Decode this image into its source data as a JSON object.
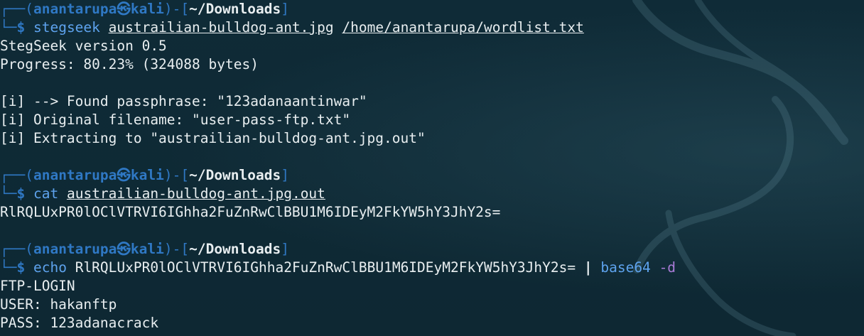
{
  "prompt": {
    "user": "anantarupa",
    "host": "kali",
    "path": "~/Downloads",
    "symbol": "$",
    "separator_icon": "kali-dragon-icon",
    "box_left": "┌──(",
    "box_mid": ")-[",
    "box_right": "]",
    "box_bottom": "└─"
  },
  "blocks": [
    {
      "command": "stegseek",
      "args": [
        "austrailian-bulldog-ant.jpg",
        "/home/anantarupa/wordlist.txt"
      ],
      "output": [
        "StegSeek version 0.5",
        "Progress: 80.23% (324088 bytes)",
        "",
        "[i] --> Found passphrase: \"123adanaantinwar\"",
        "[i] Original filename: \"user-pass-ftp.txt\"",
        "[i] Extracting to \"austrailian-bulldog-ant.jpg.out\""
      ]
    },
    {
      "command": "cat",
      "args": [
        "austrailian-bulldog-ant.jpg.out"
      ],
      "output": [
        "RlRQLUxPR0lOClVTRVI6IGhha2FuZnRwClBBU1M6IDEyM2FkYW5hY3JhY2s="
      ]
    },
    {
      "command": "echo",
      "args": [
        "RlRQLUxPR0lOClVTRVI6IGhha2FuZnRwClBBU1M6IDEyM2FkYW5hY3JhY2s="
      ],
      "pipe": "|",
      "pipe_command": "base64",
      "pipe_flag": "-d",
      "output": [
        "FTP-LOGIN",
        "USER: hakanftp",
        "PASS: 123adanacrack"
      ]
    }
  ],
  "colors": {
    "background": "#0f2a36",
    "prompt_blue": "#2f78c4",
    "command_blue": "#5ea3ee",
    "flag_purple": "#a97bd7",
    "text": "#e8eef0"
  }
}
